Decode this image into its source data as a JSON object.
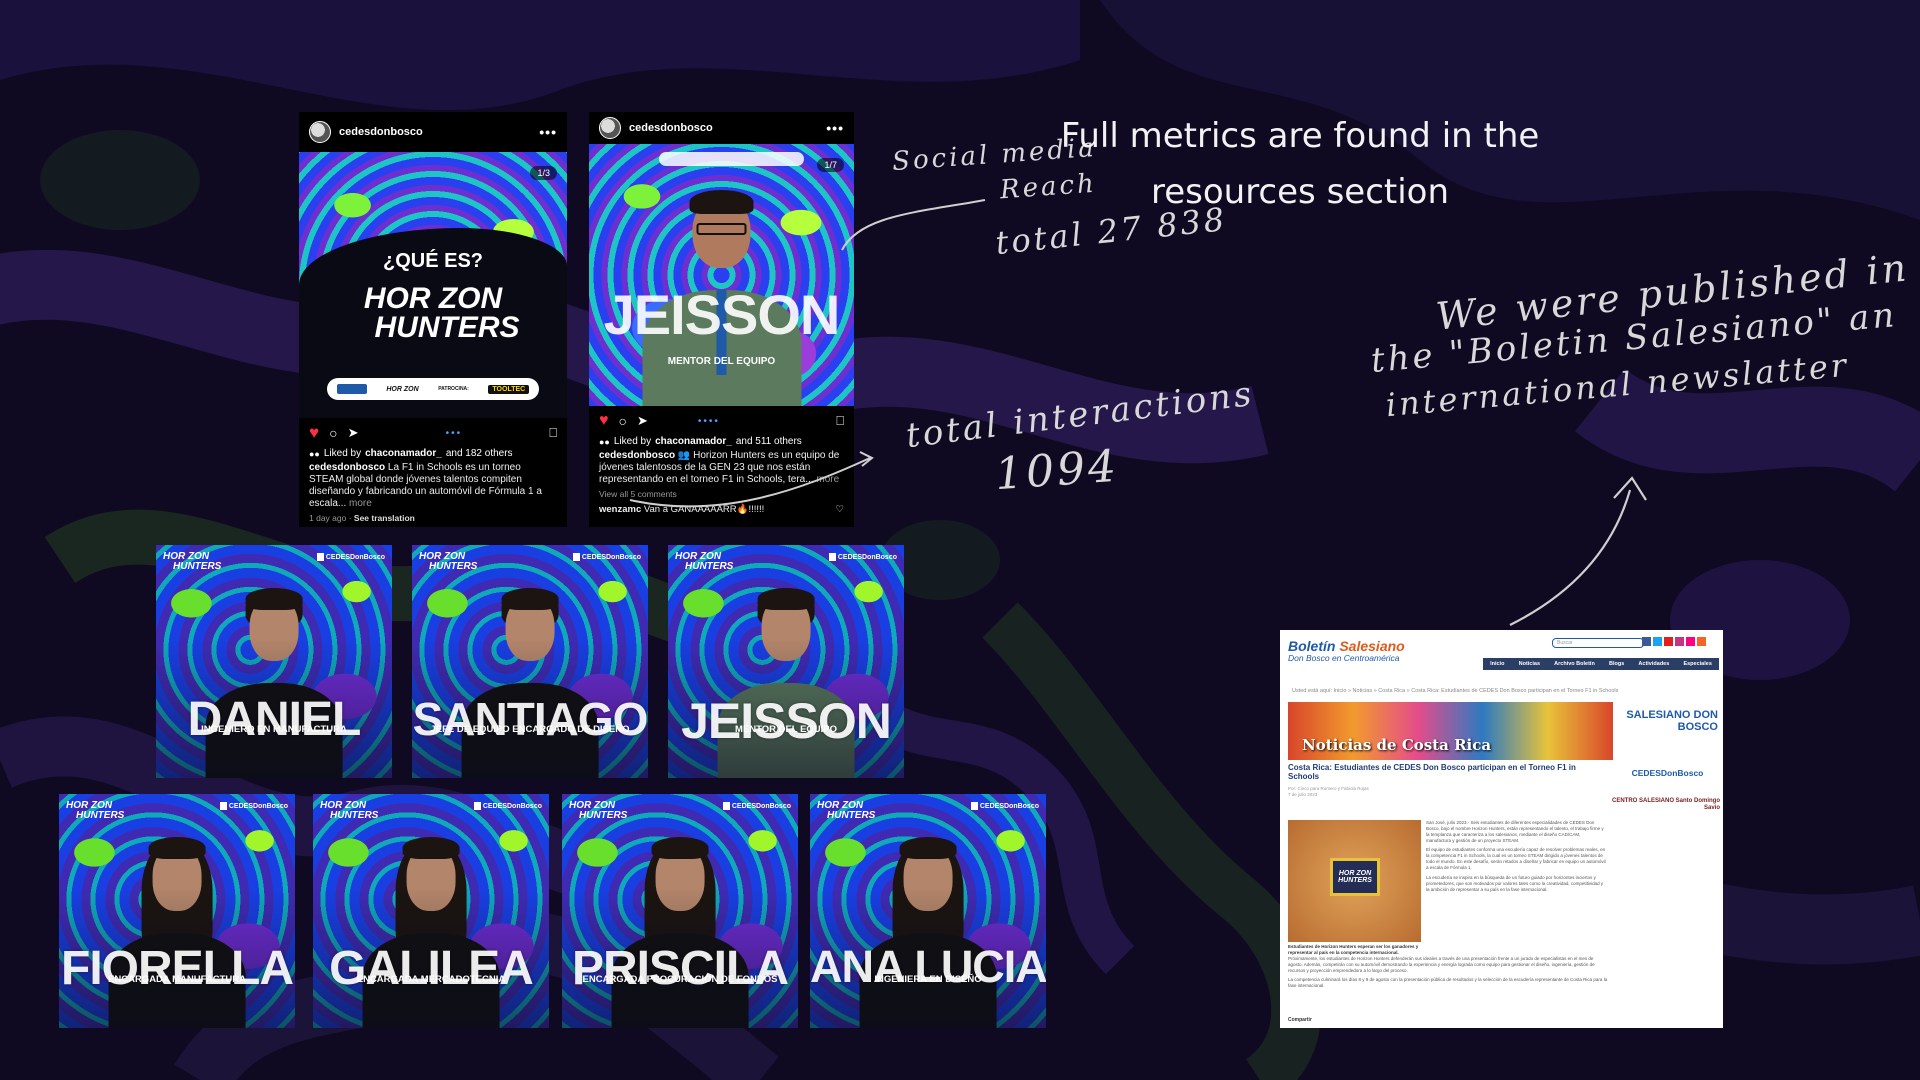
{
  "colors": {
    "background": "#0f0a22",
    "swirl_purple": "#2a1a55",
    "swirl_green": "#24401f",
    "accent_blue": "#4aa3ff",
    "like_red": "#ff3040"
  },
  "post1": {
    "username": "cedesdonbosco",
    "counter": "1/3",
    "headline": "¿QUÉ ES?",
    "brand_line1": "HOR ZON",
    "brand_line2": "HUNTERS",
    "sponsor_text": "PATROCINA:",
    "sponsor_brand": "TOOLTEC",
    "liked_by_prefix": "Liked by",
    "liked_by_user": "chaconamador_",
    "liked_by_suffix": "and 182 others",
    "caption_user": "cedesdonbosco",
    "caption": "La F1 in Schools es un torneo STEAM global donde jóvenes talentos compiten diseñando y fabricando un automóvil de Fórmula 1 a escala...",
    "more": "more",
    "time": "1 day ago",
    "translation": "See translation"
  },
  "post2": {
    "username": "cedesdonbosco",
    "counter": "1/7",
    "big_name": "JEISSON",
    "role": "MENTOR DEL EQUIPO",
    "liked_by_prefix": "Liked by",
    "liked_by_user": "chaconamador_",
    "liked_by_suffix": "and 511 others",
    "caption_user": "cedesdonbosco",
    "caption": "👥 Horizon Hunters es un equipo de jóvenes talentosos de la GEN 23 que nos están representando en el torneo F1 in Schools, tera...",
    "more": "more",
    "view_comments": "View all 5 comments",
    "comment_user": "wenzamc",
    "comment_text": "Van a GANAAAAARR🔥!!!!!!"
  },
  "card_brand_l1": "HOR ZON",
  "card_brand_l2": "HUNTERS",
  "card_brand_r": "CEDESDonBosco",
  "team": [
    {
      "name": "DANIEL",
      "role": "INGENIERO EN MANUFACTURA"
    },
    {
      "name": "SANTIAGO",
      "role": "JEFE DE EQUIPO ENCARGADO DE DISEÑO"
    },
    {
      "name": "JEISSON",
      "role": "MENTOR DEL EQUIPO"
    },
    {
      "name": "FIORELLA",
      "role": "ENCARGADA MANUFACTURA"
    },
    {
      "name": "GALILEA",
      "role": "ENCARGADA MERCADOTECNIA"
    },
    {
      "name": "PRISCILA",
      "role": "ENCARGADA PROCURACIÓN DE FONDOS"
    },
    {
      "name": "ANA LUCIA",
      "role": "INGENIERA EN DISEÑO"
    }
  ],
  "notes": {
    "reach_l1": "Social media",
    "reach_l2": "Reach",
    "reach_l3": "total 27 838",
    "inter_l1": "total interactions",
    "inter_l2": "1094",
    "metrics_l1": "Full metrics are found in the",
    "metrics_l2": "resources section",
    "pub_l1": "We were published in",
    "pub_l2": "the \"Boletin Salesiano\" an",
    "pub_l3": "international newslatter"
  },
  "newsletter": {
    "brand_a": "Boletín",
    "brand_b": "Salesiano",
    "subtitle": "Don Bosco en Centroamérica",
    "search_placeholder": "Buscar",
    "nav": [
      "Inicio",
      "Noticias",
      "Archivo Boletín",
      "Blogs",
      "Actividades",
      "Especiales"
    ],
    "breadcrumb": "Usted está aquí:  Inicio  »  Noticias  »  Costa Rica  »  Costa Rica: Estudiantes de CEDES Don Bosco participan en el Torneo F1 in Schools",
    "banner_title": "Noticias de Costa Rica",
    "side_logo1": "SALESIANO DON BOSCO",
    "side_logo2": "CEDESDonBosco",
    "side_logo3": "CENTRO SALESIANO Santo Domingo Savio",
    "headline": "Costa Rica: Estudiantes de CEDES Don Bosco participan en el Torneo F1 in Schools",
    "byline1": "Por: Cinco para Romero y Fabiola Rojas",
    "byline2": "7 de julio 2023",
    "photo_tile": "HOR ZON HUNTERS",
    "photo_caption": "Estudiantes de Horizon Hunters esperan ser los ganadores y representar al país en la competencia internacional.",
    "body1": "San José, julio 2023.- Seis estudiantes de diferentes especialidades de CEDES Don Bosco, bajo el nombre Horizon Hunters, están representando el talento, el trabajo firme y la templanza que caracteriza a los salesianos, mediante el diseño CAD/CAM, manufactura y gestión de un proyecto STEAM.",
    "body2": "El equipo de estudiantes conforma una escudería capaz de resolver problemas reales, en la competencia F1 in Schools, la cual es un torneo STEAM dirigido a jóvenes talentos de todo el mundo. En este desafío, serán retados a diseñar y fabricar en equipo un automóvil a escala de Fórmula 1.",
    "body3": "La escudería se inspira en la búsqueda de un futuro guiado por horizontes inciertos y prometedores, que son motivados por valores tales como la creatividad, competitividad y la ambición de representar a su país en la fase internacional.",
    "body4": "Próximamente, los estudiantes de Horizon Hunters defenderán sus ideales a través de una presentación frente a un jurado de especialistas en el mes de agosto. Además, competirán con su automóvil demostrando la experiencia y energía lograda como equipo para gestionar el diseño, ingeniería, gestión de recursos y proyección emprendedora a lo largo del proceso.",
    "body5": "La competencia culminará los días 8 y 9 de agosto con la presentación pública de resultados y la selección de la escudería representante de Costa Rica para la fase internacional.",
    "share": "Compartir"
  }
}
